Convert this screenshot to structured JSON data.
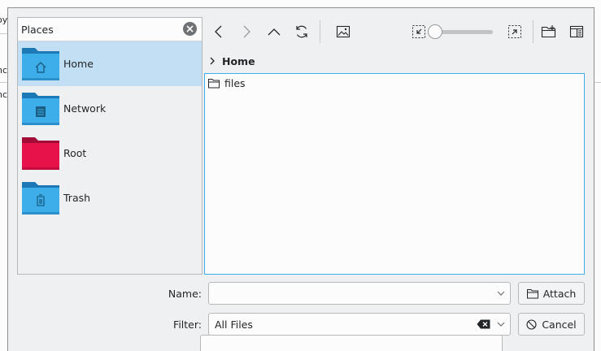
{
  "background": {
    "fragment_1": "oy",
    "fragment_2": "nc",
    "fragment_3": "nc"
  },
  "places": {
    "title": "Places",
    "items": [
      {
        "label": "Home",
        "icon": "folder-home-icon",
        "selected": true
      },
      {
        "label": "Network",
        "icon": "folder-network-icon",
        "selected": false
      },
      {
        "label": "Root",
        "icon": "folder-root-icon",
        "selected": false
      },
      {
        "label": "Trash",
        "icon": "folder-trash-icon",
        "selected": false
      }
    ]
  },
  "toolbar": {
    "buttons": [
      "back-icon",
      "forward-icon",
      "up-icon",
      "reload-icon",
      "preview-icon",
      "zoom-out-icon",
      "zoom-in-icon",
      "new-folder-icon",
      "view-options-icon"
    ],
    "zoom_level": 0
  },
  "breadcrumb": {
    "current": "Home"
  },
  "files": [
    {
      "name": "files",
      "icon": "folder-icon"
    }
  ],
  "form": {
    "name_label": "Name:",
    "name_value": "",
    "filter_label": "Filter:",
    "filter_value": "All Files",
    "attach_label": "Attach",
    "cancel_label": "Cancel"
  },
  "colors": {
    "accent": "#3daee9",
    "selection": "#c2dff3",
    "folder_blue": "#3daee9",
    "folder_red": "#e8124a"
  }
}
